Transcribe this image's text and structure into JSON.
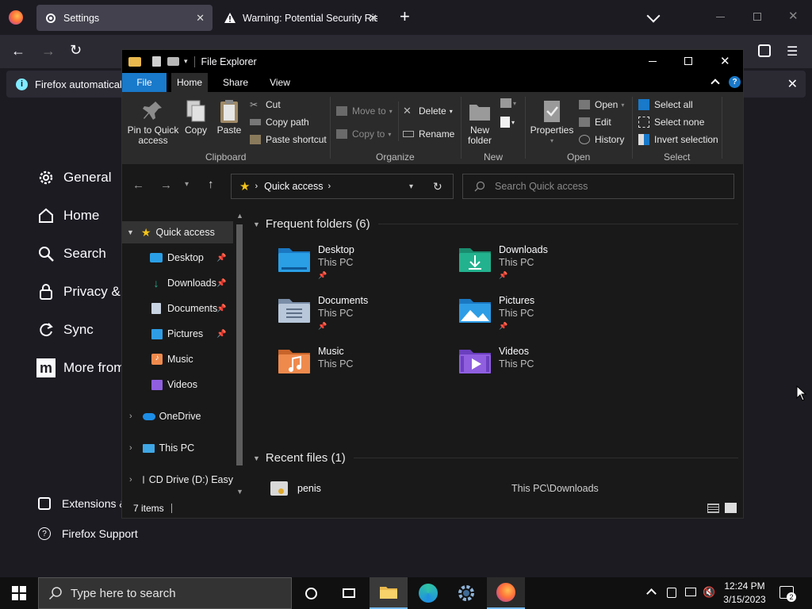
{
  "firefox": {
    "tabs": [
      {
        "title": "Settings",
        "icon": "gear-icon"
      },
      {
        "title": "Warning: Potential Security Risk",
        "icon": "warning-icon"
      }
    ],
    "notification": "Firefox automatically",
    "sidebar": [
      {
        "label": "General",
        "icon": "gear-icon"
      },
      {
        "label": "Home",
        "icon": "home-icon"
      },
      {
        "label": "Search",
        "icon": "search-icon"
      },
      {
        "label": "Privacy & S",
        "icon": "lock-icon"
      },
      {
        "label": "Sync",
        "icon": "sync-icon"
      },
      {
        "label": "More from",
        "icon": "mozilla-icon"
      }
    ],
    "footer": [
      {
        "label": "Extensions &",
        "icon": "puzzle-icon"
      },
      {
        "label": "Firefox Support",
        "icon": "help-icon"
      }
    ]
  },
  "explorer": {
    "title": "File Explorer",
    "ribbon_tabs": [
      "File",
      "Home",
      "Share",
      "View"
    ],
    "clipboard": {
      "pin": "Pin to Quick access",
      "copy": "Copy",
      "paste": "Paste",
      "cut": "Cut",
      "copy_path": "Copy path",
      "paste_shortcut": "Paste shortcut",
      "label": "Clipboard"
    },
    "organize": {
      "move_to": "Move to",
      "copy_to": "Copy to",
      "delete": "Delete",
      "rename": "Rename",
      "label": "Organize"
    },
    "new": {
      "new_folder": "New folder",
      "label": "New"
    },
    "open": {
      "properties": "Properties",
      "open": "Open",
      "edit": "Edit",
      "history": "History",
      "label": "Open"
    },
    "select": {
      "select_all": "Select all",
      "select_none": "Select none",
      "invert": "Invert selection",
      "label": "Select"
    },
    "address": "Quick access",
    "search_placeholder": "Search Quick access",
    "nav": {
      "quick_access": "Quick access",
      "items": [
        "Desktop",
        "Downloads",
        "Documents",
        "Pictures",
        "Music",
        "Videos"
      ],
      "onedrive": "OneDrive",
      "this_pc": "This PC",
      "cd_drive": "CD Drive (D:) Easy"
    },
    "frequent_header": "Frequent folders (6)",
    "folders": [
      {
        "name": "Desktop",
        "location": "This PC",
        "color": "#2a9fe6"
      },
      {
        "name": "Downloads",
        "location": "This PC",
        "color": "#23b28e"
      },
      {
        "name": "Documents",
        "location": "This PC",
        "color": "#9db4cf"
      },
      {
        "name": "Pictures",
        "location": "This PC",
        "color": "#2e9de6"
      },
      {
        "name": "Music",
        "location": "This PC",
        "color": "#ef8a4d"
      },
      {
        "name": "Videos",
        "location": "This PC",
        "color": "#8f5fe0"
      }
    ],
    "recent_header": "Recent files (1)",
    "recent_files": [
      {
        "name": "penis",
        "path": "This PC\\Downloads"
      }
    ],
    "status": "7 items"
  },
  "taskbar": {
    "search_placeholder": "Type here to search",
    "time": "12:24 PM",
    "date": "3/15/2023"
  }
}
